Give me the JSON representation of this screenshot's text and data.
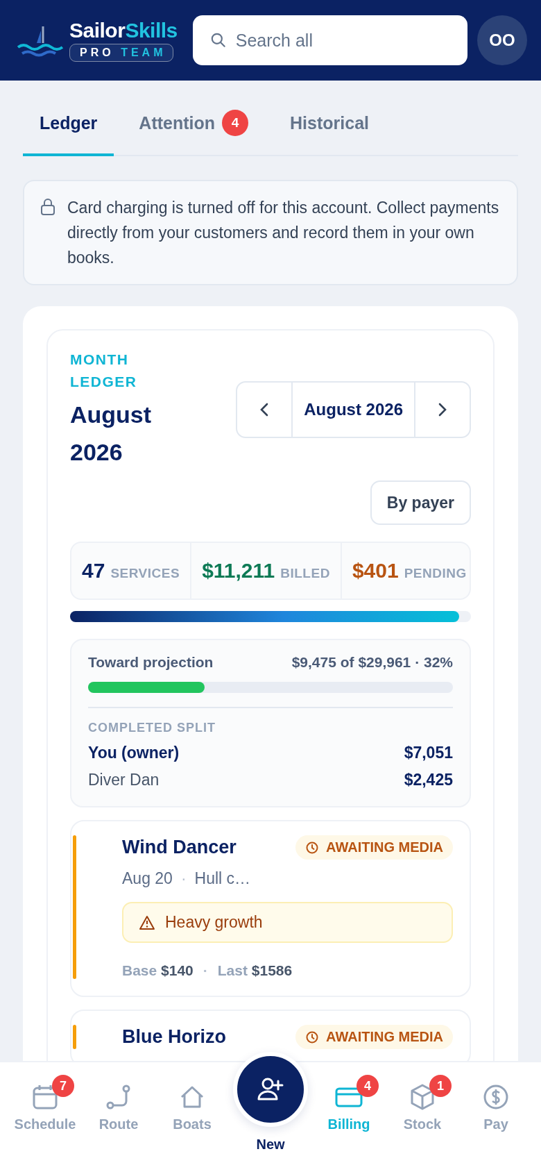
{
  "header": {
    "brand": {
      "name_first": "Sailor",
      "name_second": "Skills",
      "tag_first": "PRO",
      "tag_second": "TEAM"
    },
    "search": {
      "placeholder": "Search all"
    },
    "avatar": {
      "initials": "OO"
    }
  },
  "tabs": [
    {
      "label": "Ledger",
      "selected": true
    },
    {
      "label": "Attention",
      "selected": false,
      "badge": "4"
    },
    {
      "label": "Historical",
      "selected": false
    }
  ],
  "notice": {
    "text": "Card charging is turned off for this account. Collect payments directly from your customers and record them in your own books."
  },
  "ledger": {
    "eyebrow": "MONTH LEDGER",
    "title": "August 2026",
    "month_picker": {
      "label": "August 2026"
    },
    "group_button": "By payer",
    "stats": [
      {
        "kind": "services",
        "value": "47",
        "unit": "SERVICES"
      },
      {
        "kind": "billed",
        "value": "$11,211",
        "unit": "BILLED"
      },
      {
        "kind": "pending",
        "value": "$401",
        "unit": "PENDING"
      }
    ],
    "billed_bar": {
      "level": 0.97
    },
    "projection": {
      "label": "Toward projection",
      "summary": "$9,475 of $29,961 · 32%",
      "level": 0.32,
      "split_title": "COMPLETED SPLIT",
      "split": [
        {
          "kind": "owner",
          "name": "You (owner)",
          "amount": "$7,051"
        },
        {
          "kind": "member",
          "name": "Diver Dan",
          "amount": "$2,425"
        }
      ]
    }
  },
  "services": [
    {
      "name": "Wind Dancer",
      "status": "AWAITING MEDIA",
      "color": "#f59e0b",
      "date": "Aug 20",
      "description": "Hull c…",
      "meta_separator": "·",
      "alert": "Heavy growth",
      "base_label": "Base",
      "base": "$140",
      "price_separator": "·",
      "last_label": "Last",
      "last": "$1586"
    },
    {
      "name": "Blue Horizo",
      "status": "AWAITING MEDIA",
      "color": "#f59e0b"
    }
  ],
  "nav": [
    {
      "kind": "calendar",
      "label": "Schedule",
      "badge": "7",
      "selected": false
    },
    {
      "kind": "route",
      "label": "Route",
      "selected": false
    },
    {
      "kind": "home",
      "label": "Boats",
      "selected": false
    },
    {
      "kind": "fab",
      "label": "New",
      "selected": false
    },
    {
      "kind": "card",
      "label": "Billing",
      "badge": "4",
      "selected": true
    },
    {
      "kind": "box",
      "label": "Stock",
      "badge": "1",
      "selected": false
    },
    {
      "kind": "dollar",
      "label": "Pay",
      "selected": false
    }
  ]
}
